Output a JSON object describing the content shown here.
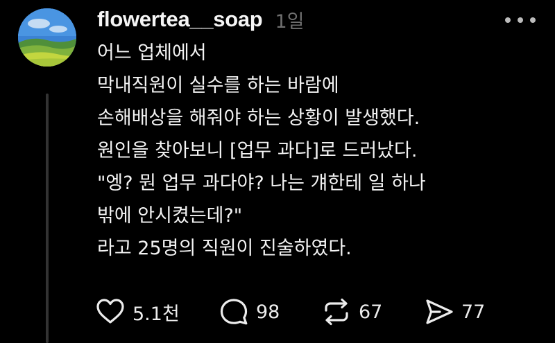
{
  "post": {
    "username": "flowertea__soap",
    "time": "1일",
    "lines": [
      "어느 업체에서",
      "막내직원이 실수를 하는 바람에",
      "손해배상을 해줘야 하는 상황이 발생했다.",
      "원인을 찾아보니 [업무 과다]로 드러났다.",
      "\"엥? 뭔 업무 과다야? 나는 걔한테 일 하나",
      "밖에 안시켰는데?\"",
      "라고 25명의 직원이 진술하였다."
    ]
  },
  "actions": {
    "like_count": "5.1천",
    "comment_count": "98",
    "repost_count": "67",
    "share_count": "77"
  },
  "icons": {
    "avatar": "landscape-avatar",
    "more": "more-dots-icon",
    "like": "heart-icon",
    "comment": "comment-bubble-icon",
    "repost": "repost-icon",
    "share": "send-icon"
  },
  "colors": {
    "background": "#000000",
    "text": "#f3f3f3",
    "muted": "#6f6f6f",
    "thread_line": "#333333"
  }
}
